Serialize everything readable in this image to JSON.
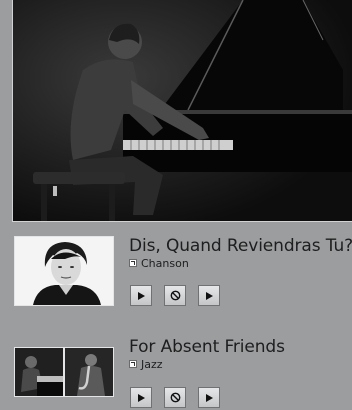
{
  "hero": {
    "image": "pianist-performing-grand-piano-bw-photo"
  },
  "tracks": [
    {
      "title": "Dis, Quand Reviendras Tu?",
      "genre": "Chanson",
      "thumbnail": "portrait-woman-short-hair-bw",
      "buttons": [
        "play-icon",
        "stop-icon",
        "play-next-icon"
      ]
    },
    {
      "title": "For Absent Friends",
      "genre": "Jazz",
      "thumbnail": "pianist-and-saxophonist-bw",
      "buttons": [
        "play-icon",
        "stop-icon",
        "play-next-icon"
      ]
    }
  ],
  "colors": {
    "background": "#9b9d9f",
    "text": "#1e1e1e",
    "button_border": "#6f7173"
  }
}
